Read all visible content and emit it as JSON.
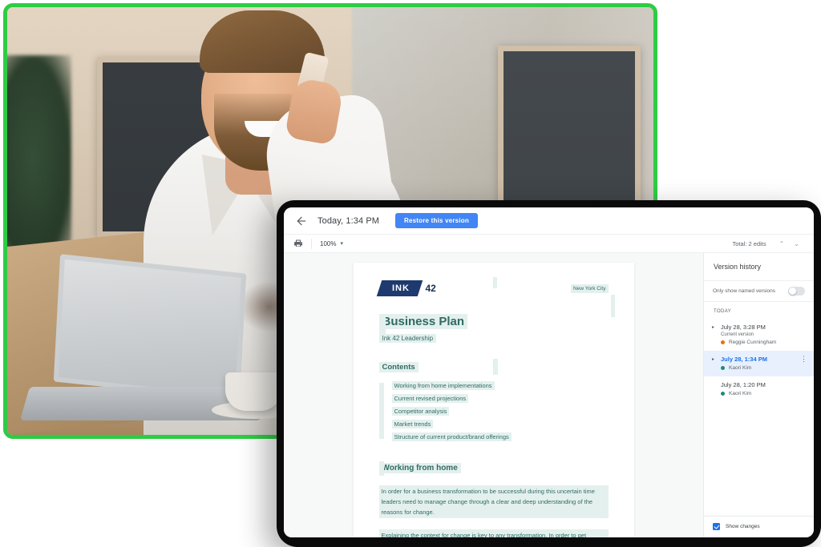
{
  "photo": {
    "alt_description": "Smiling bearded man in white shirt talking on mobile phone at a desk with laptop and coffee cup",
    "border_color": "#2ecc44"
  },
  "appbar": {
    "back_icon": "arrow-left-icon",
    "title": "Today, 1:34 PM",
    "restore_label": "Restore this version",
    "restore_color": "#4285f4"
  },
  "toolbar": {
    "print_icon": "printer-icon",
    "zoom_value": "100%",
    "zoom_caret": "▾",
    "edits_label": "Total: 2 edits",
    "prev_icon": "chevron-up-icon",
    "next_icon": "chevron-down-icon",
    "prev_glyph": "⌃",
    "next_glyph": "⌄"
  },
  "document": {
    "logo_text": "INK",
    "logo_number": "42",
    "city": "New York City",
    "title": "Business Plan",
    "subtitle": "Ink 42 Leadership",
    "contents_heading": "Contents",
    "contents_items": [
      "Working from home implementations",
      "Current revised projections",
      "Competitor analysis",
      "Market trends",
      "Structure of current product/brand offerings"
    ],
    "arrow_glyph": "→",
    "section_heading": "Working from home",
    "paragraph_1": "In order for a business transformation to be successful during this uncertain time leaders need to manage change through a clear and deep understanding of the reasons for change.",
    "paragraph_2": "Explaining the context for change is key to any transformation. In order to get",
    "highlight_color": "#e4f0ee",
    "text_color": "#2f6b63"
  },
  "version_panel": {
    "title": "Version history",
    "filter_label": "Only show named versions",
    "filter_state": "off",
    "day_group": "TODAY",
    "versions": [
      {
        "date": "July 28, 3:28 PM",
        "note": "Current version",
        "author": "Reggie Cunningham",
        "dot_color": "#e8710a",
        "selected": false,
        "expand_glyph": "▸"
      },
      {
        "date": "July 28, 1:34 PM",
        "note": "",
        "author": "Kaori Kim",
        "dot_color": "#1a8b7d",
        "selected": true,
        "expand_glyph": "▸",
        "menu_glyph": "⋮"
      },
      {
        "date": "July 28, 1:20 PM",
        "note": "",
        "author": "Kaori Kim",
        "dot_color": "#1a8b7d",
        "selected": false,
        "expand_glyph": ""
      }
    ],
    "footer_checkbox_label": "Show changes",
    "footer_checkbox_checked": true,
    "accent_color": "#1a73e8"
  }
}
